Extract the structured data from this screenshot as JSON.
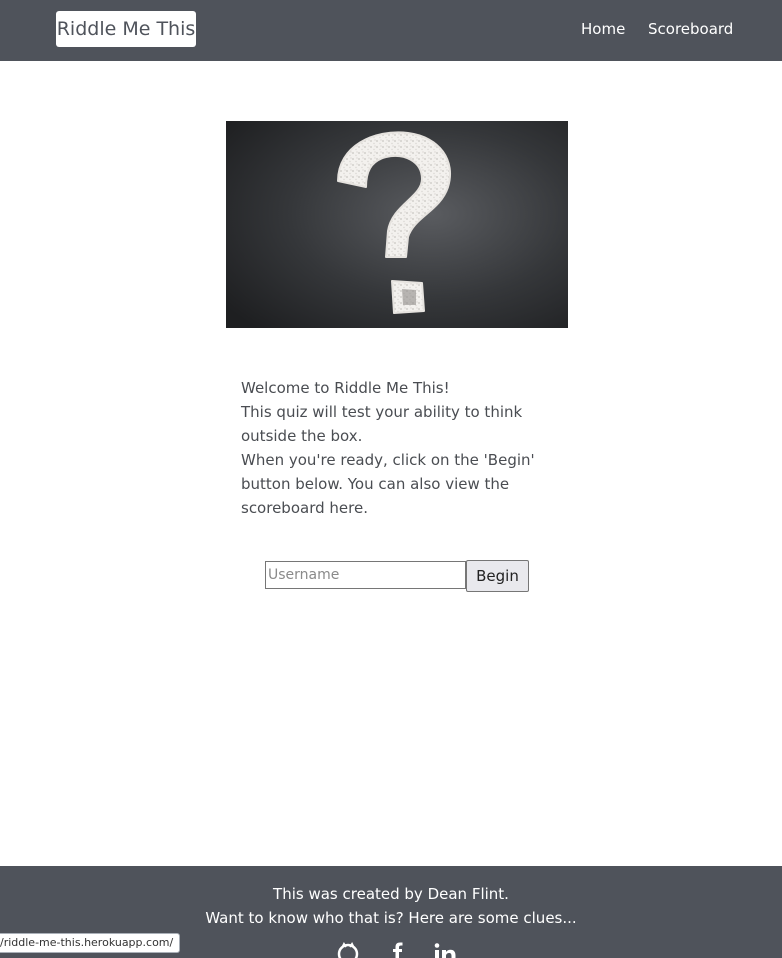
{
  "navbar": {
    "brand": "Riddle Me This",
    "links": [
      {
        "label": "Home"
      },
      {
        "label": "Scoreboard"
      }
    ]
  },
  "hero": {
    "image_icon": "question-mark-chalkboard-image"
  },
  "intro": {
    "line1": "Welcome to Riddle Me This!",
    "line2": "This quiz will test your ability to think outside the box.",
    "line3": "When you're ready, click on the 'Begin' button below. You can also view the scoreboard here."
  },
  "form": {
    "username_placeholder": "Username",
    "username_value": "",
    "begin_label": "Begin"
  },
  "footer": {
    "line1": "This was created by Dean Flint.",
    "line2": "Want to know who that is? Here are some clues...",
    "social_icons": [
      "github-icon",
      "facebook-icon",
      "linkedin-icon"
    ]
  },
  "status_bar": {
    "url": "/riddle-me-this.herokuapp.com/"
  },
  "colors": {
    "navbar_bg": "#4f535b",
    "footer_bg": "#4f535b",
    "text": "#4a4d52"
  }
}
